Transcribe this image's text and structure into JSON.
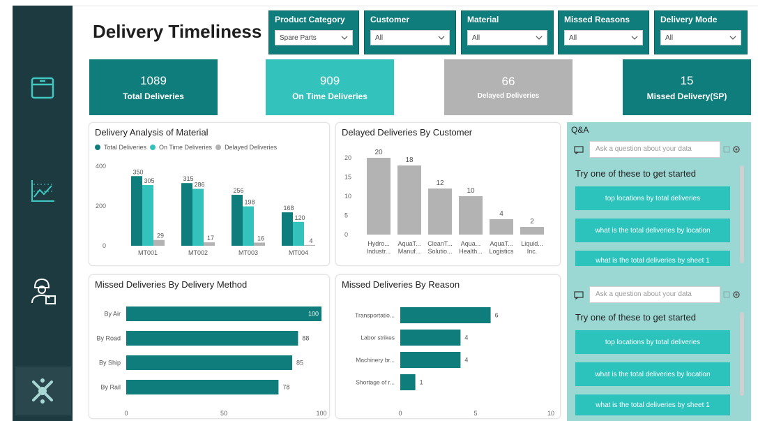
{
  "title": "Delivery Timeliness",
  "filters": [
    {
      "label": "Product Category",
      "value": "Spare Parts"
    },
    {
      "label": "Customer",
      "value": "All"
    },
    {
      "label": "Material",
      "value": "All"
    },
    {
      "label": "Missed Reasons",
      "value": "All"
    },
    {
      "label": "Delivery Mode",
      "value": "All"
    }
  ],
  "kpis": [
    {
      "value": "1089",
      "label": "Total Deliveries",
      "color": "#0f7d7b"
    },
    {
      "value": "909",
      "label": "On Time Deliveries",
      "color": "#34c3bc"
    },
    {
      "value": "66",
      "label": "Delayed Deliveries",
      "color": "#b3b3b3"
    },
    {
      "value": "15",
      "label": "Missed Delivery(SP)",
      "color": "#0f7d7b"
    }
  ],
  "sidebar": {
    "icons": [
      "box-icon",
      "line-chart-icon",
      "worker-icon",
      "logo-icon"
    ]
  },
  "colors": {
    "teal": "#0f7d7b",
    "aqua": "#34c3bc",
    "gray": "#b3b3b3"
  },
  "chart_data": [
    {
      "id": "material",
      "type": "bar",
      "title": "Delivery Analysis of Material",
      "legend_placement": "top-left",
      "categories": [
        "MT001",
        "MT002",
        "MT003",
        "MT004"
      ],
      "series": [
        {
          "name": "Total Deliveries",
          "values": [
            350,
            315,
            256,
            168
          ]
        },
        {
          "name": "On Time Deliveries",
          "values": [
            305,
            286,
            198,
            120
          ]
        },
        {
          "name": "Delayed Deliveries",
          "values": [
            29,
            17,
            16,
            4
          ]
        }
      ],
      "yticks": [
        "0",
        "200",
        "400"
      ],
      "ylim": [
        0,
        400
      ]
    },
    {
      "id": "customer",
      "type": "bar",
      "title": "Delayed Deliveries By Customer",
      "categories": [
        [
          "Hydro...",
          "Industr..."
        ],
        [
          "AquaT...",
          "Manuf..."
        ],
        [
          "CleanT...",
          "Solutio..."
        ],
        [
          "Aqua...",
          "Health..."
        ],
        [
          "AquaT...",
          "Logistics"
        ],
        [
          "Liquid...",
          "Inc."
        ]
      ],
      "values": [
        20,
        18,
        12,
        10,
        4,
        2
      ],
      "yticks": [
        "0",
        "5",
        "10",
        "15",
        "20"
      ],
      "ylim": [
        0,
        20
      ]
    },
    {
      "id": "method",
      "type": "bar",
      "orientation": "horizontal",
      "title": "Missed Deliveries By Delivery Method",
      "categories": [
        "By Air",
        "By Road",
        "By Ship",
        "By Rail"
      ],
      "values": [
        100,
        88,
        85,
        78
      ],
      "xticks": [
        "0",
        "50",
        "100"
      ],
      "xlim": [
        0,
        100
      ]
    },
    {
      "id": "reason",
      "type": "bar",
      "orientation": "horizontal",
      "title": "Missed Deliveries By Reason",
      "categories": [
        "Transportatio...",
        "Labor strikes",
        "Machinery br...",
        "Shortage of r..."
      ],
      "values": [
        6,
        4,
        4,
        1
      ],
      "xticks": [
        "0",
        "5",
        "10"
      ],
      "xlim": [
        0,
        10
      ]
    }
  ],
  "qa": {
    "title": "Q&A",
    "placeholder": "Ask a question about your data",
    "try_text": "Try one of these to get started",
    "suggestions": [
      "top locations by total deliveries",
      "what is the total deliveries by location",
      "what is the total deliveries by sheet 1"
    ]
  }
}
